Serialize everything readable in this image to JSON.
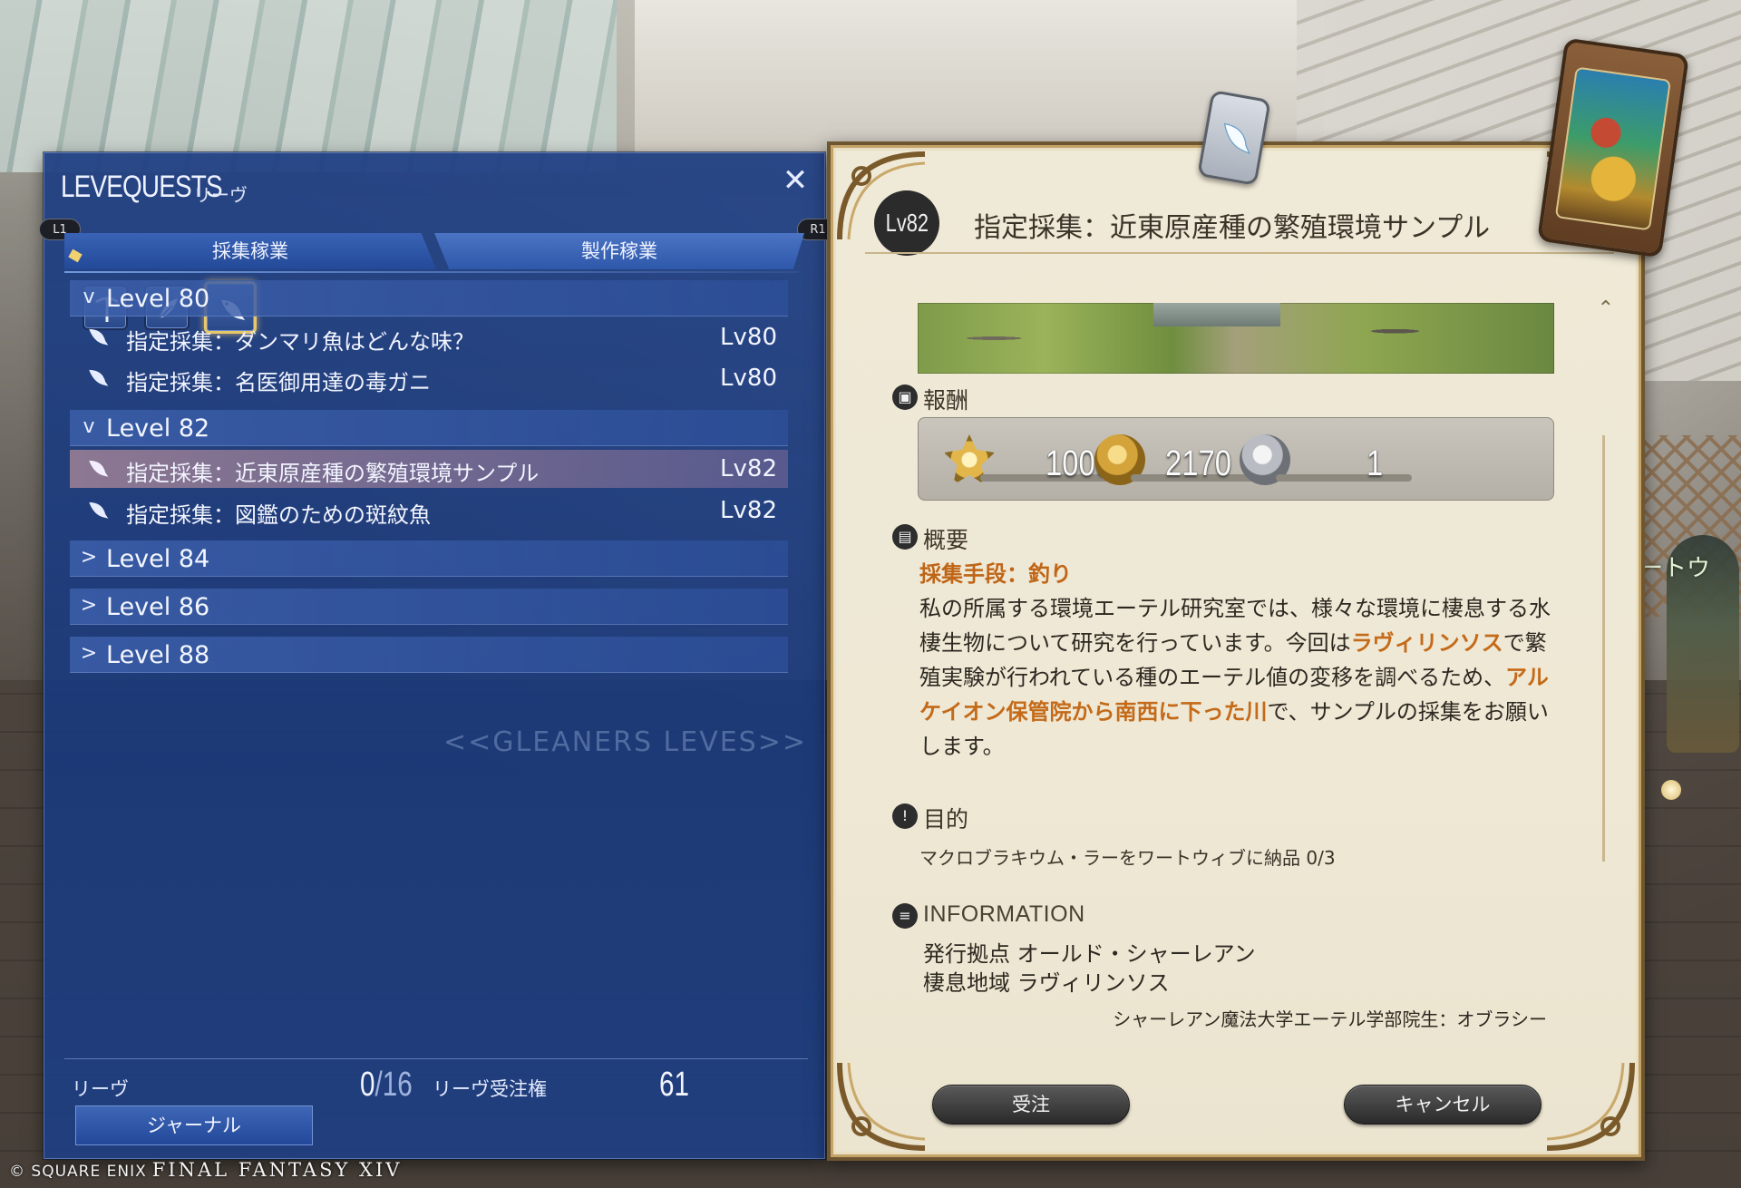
{
  "left_panel": {
    "title": "LEVEQUESTS",
    "subtitle": "リーヴ",
    "close_glyph": "✕",
    "shoulder_left": "L1",
    "shoulder_right": "R1",
    "tabs": [
      {
        "label": "採集稼業",
        "active": true
      },
      {
        "label": "製作稼業",
        "active": false
      }
    ],
    "class_icons": [
      "pickaxe-icon",
      "feather-icon",
      "fish-icon"
    ],
    "groups": [
      {
        "label": "Level 80",
        "expanded": true,
        "quests": [
          {
            "name": "指定採集：ダンマリ魚はどんな味？",
            "level": "Lv80"
          },
          {
            "name": "指定採集：名医御用達の毒ガニ",
            "level": "Lv80"
          }
        ]
      },
      {
        "label": "Level 82",
        "expanded": true,
        "quests": [
          {
            "name": "指定採集：近東原産種の繁殖環境サンプル",
            "level": "Lv82",
            "selected": true
          },
          {
            "name": "指定採集：図鑑のための斑紋魚",
            "level": "Lv82"
          }
        ]
      },
      {
        "label": "Level 84",
        "expanded": false
      },
      {
        "label": "Level 86",
        "expanded": false
      },
      {
        "label": "Level 88",
        "expanded": false
      }
    ],
    "watermark": "<<GLEANERS LEVES>>",
    "footer": {
      "leves_label": "リーヴ",
      "leves_count": "0",
      "leves_max": "/16",
      "allowance_label": "リーヴ受注権",
      "allowance_value": "61",
      "journal_button": "ジャーナル"
    }
  },
  "detail": {
    "level_badge": "Lv82",
    "title": "指定採集：近東原産種の繁殖環境サンプル",
    "rewards_label": "報酬",
    "rewards": [
      {
        "icon": "exp-icon",
        "value": "1000"
      },
      {
        "icon": "gil-icon",
        "value": "2170"
      },
      {
        "icon": "seal-icon",
        "value": "1"
      }
    ],
    "overview_label": "概要",
    "method": "採集手段：釣り",
    "description_parts": [
      "私の所属する環境エーテル研究室では、様々な環境に棲息する水棲生物について研究を行っています。今回は",
      "ラヴィリンソス",
      "で繁殖実験が行われている種のエーテル値の変移を調べるため、",
      "アルケイオン保管院から南西に下った川",
      "で、サンプルの採集をお願いします。"
    ],
    "objective_label": "目的",
    "objective": "マクロブラキウム・ラーをワートウィブに納品 0/3",
    "information_label": "INFORMATION",
    "info_lines": [
      "発行拠点 オールド・シャーレアン",
      "棲息地域 ラヴィリンソス"
    ],
    "issuer": "シャーレアン魔法大学エーテル学部院生：オブラシー",
    "accept_button": "受注",
    "cancel_button": "キャンセル"
  },
  "background": {
    "npc_name_fragment": "ワートウ"
  },
  "copyright": {
    "company": "© SQUARE ENIX",
    "game": "FINAL FANTASY XIV"
  },
  "colors": {
    "panel_blue": "#1e3e82",
    "parchment": "#efe9d7",
    "highlight_orange": "#c46a18",
    "selected_row": "#a0829a"
  }
}
